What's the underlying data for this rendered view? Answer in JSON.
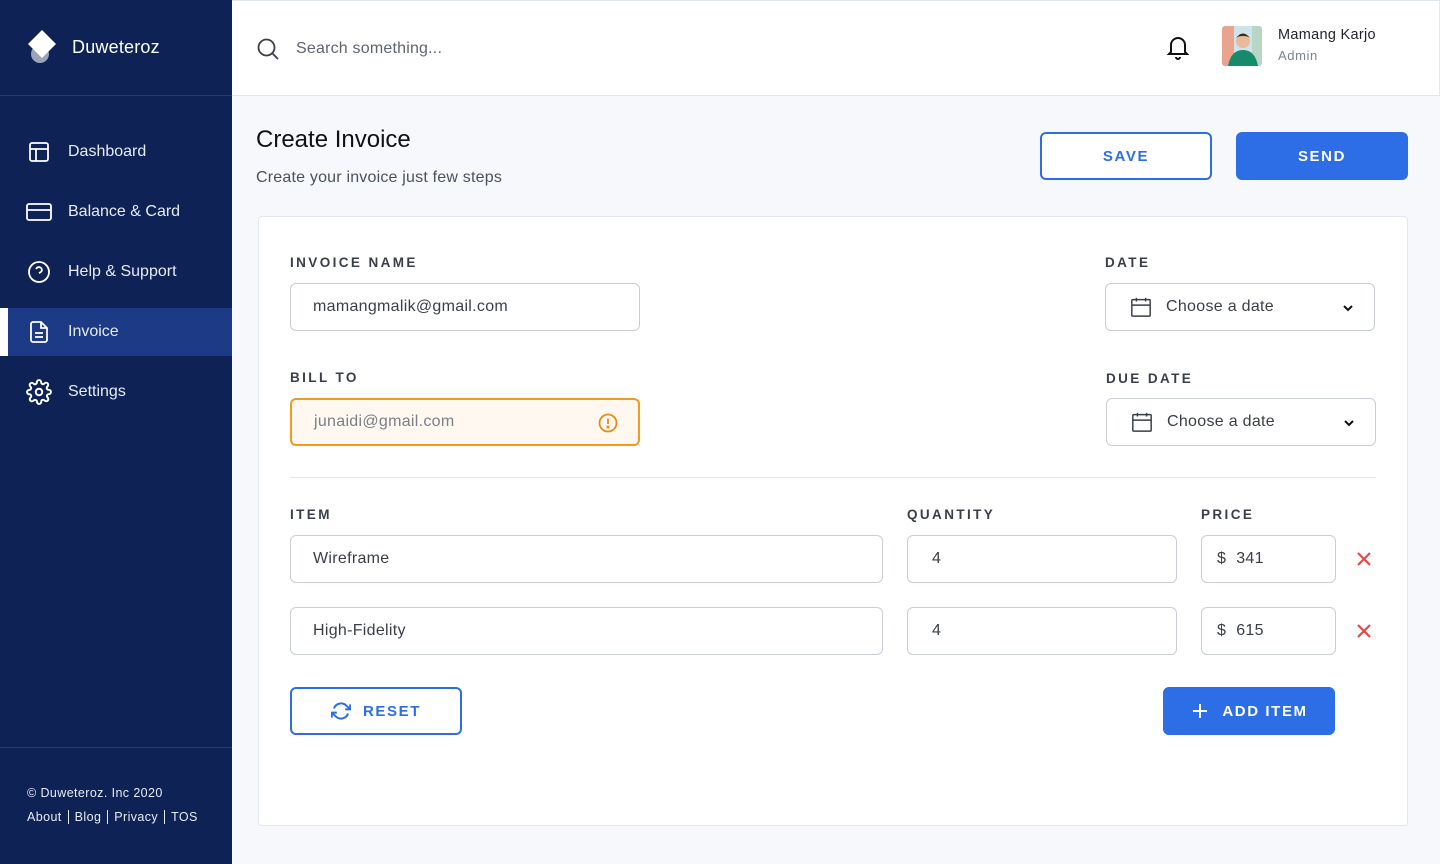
{
  "brand": {
    "name": "Duweteroz",
    "logo_icon": "diamond-logo-icon"
  },
  "sidebar": {
    "items": [
      {
        "label": "Dashboard",
        "icon": "layout-icon",
        "active": false
      },
      {
        "label": "Balance & Card",
        "icon": "credit-card-icon",
        "active": false
      },
      {
        "label": "Help & Support",
        "icon": "help-circle-icon",
        "active": false
      },
      {
        "label": "Invoice",
        "icon": "document-icon",
        "active": true
      },
      {
        "label": "Settings",
        "icon": "gear-icon",
        "active": false
      }
    ],
    "footer": {
      "copyright": "© Duweteroz. Inc 2020",
      "links": [
        "About",
        "Blog",
        "Privacy",
        "TOS"
      ]
    }
  },
  "topbar": {
    "search_placeholder": "Search something...",
    "user": {
      "name": "Mamang Karjo",
      "role": "Admin"
    }
  },
  "page": {
    "title": "Create Invoice",
    "subtitle": "Create your invoice just few steps",
    "save_label": "SAVE",
    "send_label": "SEND"
  },
  "form": {
    "invoice_name": {
      "label": "INVOICE NAME",
      "value": "mamangmalik@gmail.com"
    },
    "bill_to": {
      "label": "BILL TO",
      "value": "junaidi@gmail.com",
      "status": "warning"
    },
    "date": {
      "label": "DATE",
      "placeholder": "Choose a date"
    },
    "due_date": {
      "label": "DUE DATE",
      "placeholder": "Choose a date"
    },
    "columns": {
      "item": "ITEM",
      "quantity": "QUANTITY",
      "price": "PRICE"
    },
    "items": [
      {
        "name": "Wireframe",
        "quantity": "4",
        "currency": "$",
        "price": "341"
      },
      {
        "name": "High-Fidelity",
        "quantity": "4",
        "currency": "$",
        "price": "615"
      }
    ],
    "reset_label": "RESET",
    "add_item_label": "ADD ITEM"
  },
  "colors": {
    "sidebar_bg": "#0e2256",
    "active_nav_bg": "#1c3a85",
    "primary": "#2d6ee6",
    "warning": "#f29a1f",
    "danger": "#e54848"
  }
}
